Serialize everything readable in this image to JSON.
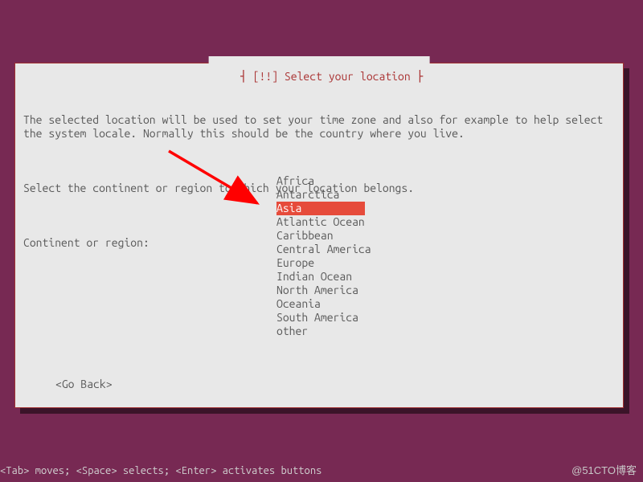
{
  "dialog": {
    "title_prefix": "┤ ",
    "title_marker": "[!!]",
    "title_text": " Select your location",
    "title_suffix": " ├",
    "para1": "The selected location will be used to set your time zone and also for example to help select the system locale. Normally this should be the country where you live.",
    "para2": "Select the continent or region to which your location belongs.",
    "label": "Continent or region:",
    "go_back": "<Go Back>"
  },
  "list": {
    "items": [
      "Africa",
      "Antarctica",
      "Asia",
      "Atlantic Ocean",
      "Caribbean",
      "Central America",
      "Europe",
      "Indian Ocean",
      "North America",
      "Oceania",
      "South America",
      "other"
    ],
    "selected_index": 2
  },
  "footer": {
    "hints": "<Tab> moves; <Space> selects; <Enter> activates buttons",
    "watermark": "@51CTO博客"
  },
  "colors": {
    "bg": "#772953",
    "dialog_bg": "#e8e8e8",
    "accent": "#aa3333",
    "highlight": "#e64b3b",
    "arrow": "#ff0000"
  }
}
